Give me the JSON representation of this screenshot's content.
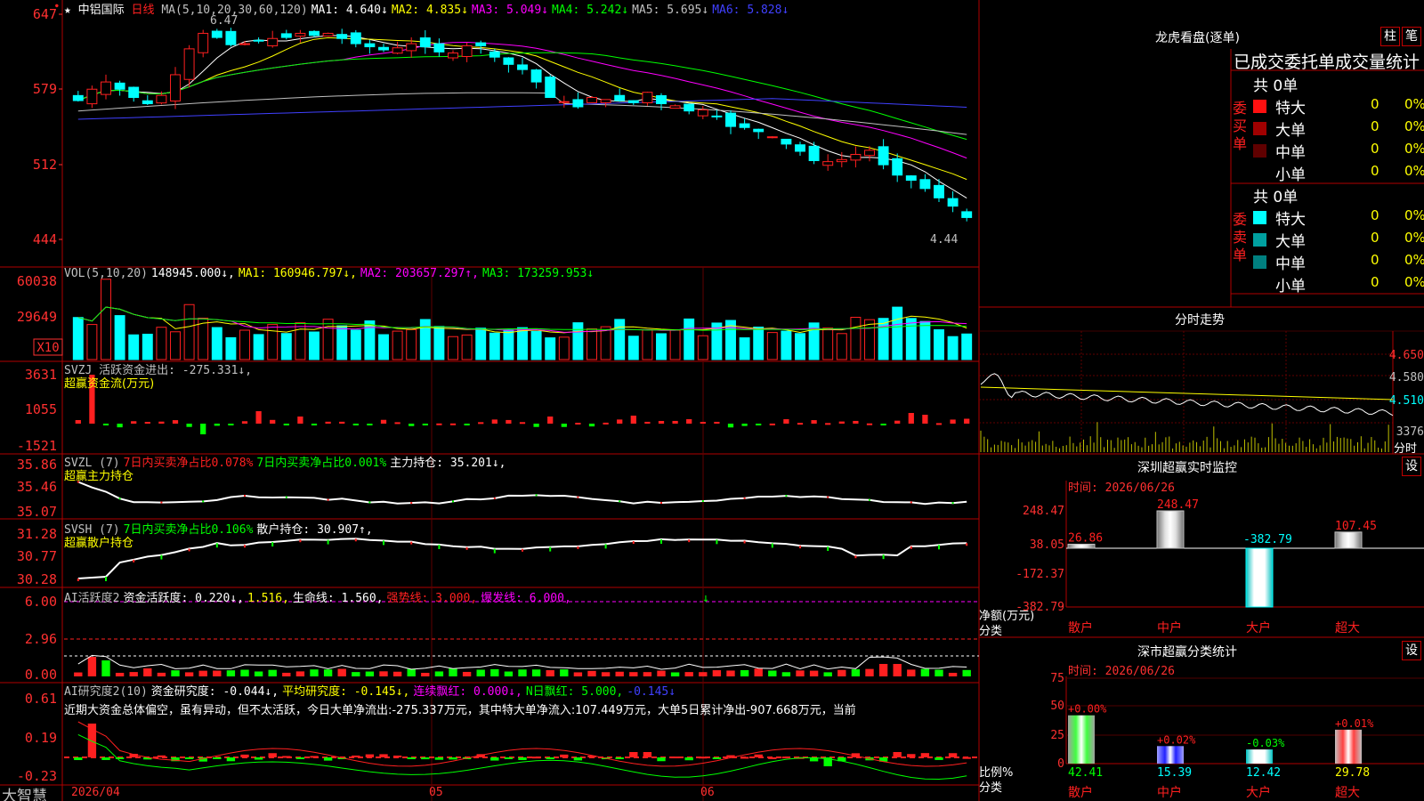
{
  "colors": {
    "up": "#ff2020",
    "down": "#00ffff",
    "green": "#00ff00",
    "white": "#ffffff",
    "yellow": "#ffff00",
    "magenta": "#ff00ff",
    "ma5": "#00a000",
    "blue": "#4040ff",
    "grid": "#b00000",
    "axis": "#ff3030"
  },
  "main": {
    "star": "★",
    "name": "中铝国际",
    "period": "日线",
    "ma_items": [
      {
        "t": "MA(5,10,20,30,60,120)",
        "c": "#c0c0c0"
      },
      {
        "t": "MA1: 4.640↓",
        "c": "#ffffff"
      },
      {
        "t": "MA2: 4.835↓",
        "c": "#ffff00"
      },
      {
        "t": "MA3: 5.049↓",
        "c": "#ff00ff"
      },
      {
        "t": "MA4: 5.242↓",
        "c": "#00ff00"
      },
      {
        "t": "MA5: 5.695↓",
        "c": "#c0c0c0"
      },
      {
        "t": "MA6: 5.828↓",
        "c": "#4040ff"
      }
    ],
    "yticks": [
      "647",
      "579",
      "512",
      "444"
    ],
    "high_label": "6.47",
    "low_label": "4.44"
  },
  "vol": {
    "items": [
      {
        "t": "VOL(5,10,20)",
        "c": "#c0c0c0"
      },
      {
        "t": "148945.000↓,",
        "c": "#ffffff"
      },
      {
        "t": "MA1: 160946.797↓,",
        "c": "#ffff00"
      },
      {
        "t": "MA2: 203657.297↑,",
        "c": "#ff00ff"
      },
      {
        "t": "MA3: 173259.953↓",
        "c": "#00ff00"
      }
    ],
    "yticks": [
      "60038",
      "29649"
    ],
    "unit": "X10"
  },
  "svzj": {
    "items": [
      {
        "t": "SVZJ  活跃资金进出: -275.331↓,",
        "c": "#c0c0c0"
      }
    ],
    "sub": "超赢资金流(万元)",
    "yticks": [
      "3631",
      "1055",
      "-1521"
    ]
  },
  "svzl": {
    "items": [
      {
        "t": "SVZL (7)",
        "c": "#c0c0c0"
      },
      {
        "t": "7日内买卖净占比0.078%",
        "c": "#ff2020"
      },
      {
        "t": "7日内买卖净占比0.001%",
        "c": "#00ff00"
      },
      {
        "t": "主力持仓: 35.201↓,",
        "c": "#ffffff"
      }
    ],
    "sub": "超赢主力持仓",
    "yticks": [
      "35.86",
      "35.46",
      "35.07"
    ]
  },
  "svsh": {
    "items": [
      {
        "t": "SVSH (7)",
        "c": "#c0c0c0"
      },
      {
        "t": "7日内买卖净占比0.106%",
        "c": "#00ff00"
      },
      {
        "t": "散户持仓: 30.907↑,",
        "c": "#ffffff"
      }
    ],
    "sub": "超赢散户持仓",
    "yticks": [
      "31.28",
      "30.77",
      "30.28"
    ]
  },
  "ai1": {
    "items": [
      {
        "t": "AI活跃度2",
        "c": "#c0c0c0"
      },
      {
        "t": "资金活跃度: 0.220↓,",
        "c": "#ffffff"
      },
      {
        "t": "1.516,",
        "c": "#ffff00"
      },
      {
        "t": "生命线: 1.560,",
        "c": "#ffffff"
      },
      {
        "t": "强势线: 3.000,",
        "c": "#ff2020"
      },
      {
        "t": "爆发线: 6.000,",
        "c": "#ff00ff"
      }
    ],
    "yticks": [
      "6.00",
      "2.96",
      "0.00"
    ]
  },
  "ai2": {
    "items": [
      {
        "t": "AI研究度2(10)",
        "c": "#c0c0c0"
      },
      {
        "t": "资金研究度: -0.044↓,",
        "c": "#ffffff"
      },
      {
        "t": "平均研究度: -0.145↓,",
        "c": "#ffff00"
      },
      {
        "t": "连续飘红: 0.000↓,",
        "c": "#ff00ff"
      },
      {
        "t": "N日飘红: 5.000,",
        "c": "#00ff00"
      },
      {
        "t": "-0.145↓",
        "c": "#4040ff"
      }
    ],
    "text": "近期大资金总体偏空，虽有异动，但不太活跃，今日大单净流出:-275.337万元，其中特大单净流入:107.449万元，大单5日累计净出-907.668万元，当前",
    "yticks": [
      "0.61",
      "0.19",
      "-0.23"
    ]
  },
  "xaxis": {
    "brand": "大智慧",
    "labels": [
      "2026/04",
      "05",
      "06"
    ]
  },
  "lhb": {
    "title": "龙虎看盘(逐单)",
    "btn1": "柱",
    "btn2": "笔",
    "header": "已成交委托单成交量统计",
    "buy": {
      "vlabel": "委买单",
      "count": "共 0单",
      "rows": [
        {
          "name": "特大",
          "val": "0",
          "pct": "0%",
          "c": "#ff1010"
        },
        {
          "name": "大单",
          "val": "0",
          "pct": "0%",
          "c": "#a00000"
        },
        {
          "name": "中单",
          "val": "0",
          "pct": "0%",
          "c": "#600000"
        },
        {
          "name": "小单",
          "val": "0",
          "pct": "0%",
          "c": ""
        }
      ]
    },
    "sell": {
      "vlabel": "委卖单",
      "count": "共 0单",
      "rows": [
        {
          "name": "特大",
          "val": "0",
          "pct": "0%",
          "c": "#00ffff"
        },
        {
          "name": "大单",
          "val": "0",
          "pct": "0%",
          "c": "#00a0a0"
        },
        {
          "name": "中单",
          "val": "0",
          "pct": "0%",
          "c": "#008080"
        },
        {
          "name": "小单",
          "val": "0",
          "pct": "0%",
          "c": ""
        }
      ]
    }
  },
  "fenshi": {
    "title": "分时走势",
    "yticks": [
      "4.650",
      "4.580",
      "4.510"
    ],
    "vol_label": "3376",
    "footer": "分时"
  },
  "monitor": {
    "title": "深圳超赢实时监控",
    "btn": "设",
    "time": "时间: 2026/06/26",
    "yticks": [
      "248.47",
      "38.05",
      "-172.37",
      "-382.79"
    ],
    "ylabel": "净额(万元)",
    "xtitle": "分类",
    "cats": [
      "散户",
      "中户",
      "大户",
      "超大"
    ],
    "values": [
      26.86,
      248.47,
      -382.79,
      107.45
    ],
    "value_labels": [
      "26.86",
      "248.47",
      "-382.79",
      "107.45"
    ]
  },
  "stats": {
    "title": "深市超赢分类统计",
    "btn": "设",
    "time": "时间: 2026/06/26",
    "yticks": [
      "75",
      "50",
      "25",
      "0"
    ],
    "ylabel": "比例%",
    "xtitle": "分类",
    "cats": [
      "散户",
      "中户",
      "大户",
      "超大"
    ],
    "values": [
      42.41,
      15.39,
      12.42,
      29.78
    ],
    "top_labels": [
      "+0.00%",
      "+0.02%",
      "-0.03%",
      "+0.01%"
    ],
    "value_labels": [
      "42.41",
      "15.39",
      "12.42",
      "29.78"
    ]
  },
  "chart_data": {
    "type": "bar",
    "title": "深圳超赢实时监控",
    "categories": [
      "散户",
      "中户",
      "大户",
      "超大"
    ],
    "series": [
      {
        "name": "净额(万元)",
        "values": [
          26.86,
          248.47,
          -382.79,
          107.45
        ]
      }
    ],
    "ylim": [
      -382.79,
      248.47
    ]
  }
}
